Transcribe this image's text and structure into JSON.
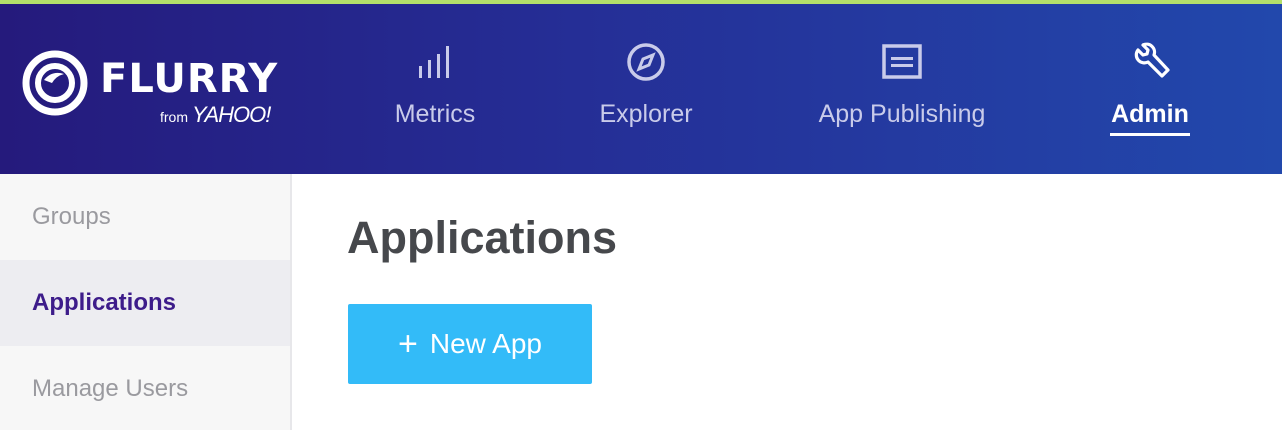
{
  "brand": {
    "name": "FLURRY",
    "from_text": "from",
    "partner": "YAHOO!"
  },
  "nav": {
    "items": [
      {
        "label": "Metrics",
        "icon": "bar-chart-icon"
      },
      {
        "label": "Explorer",
        "icon": "compass-icon"
      },
      {
        "label": "App Publishing",
        "icon": "document-icon"
      },
      {
        "label": "Admin",
        "icon": "wrench-icon"
      }
    ],
    "active": "Admin"
  },
  "sidebar": {
    "items": [
      {
        "label": "Groups"
      },
      {
        "label": "Applications"
      },
      {
        "label": "Manage Users"
      }
    ],
    "active": "Applications"
  },
  "main": {
    "title": "Applications",
    "new_app_button": {
      "icon": "+",
      "label": "New App"
    }
  },
  "colors": {
    "header_start": "#251a7c",
    "header_end": "#2248ac",
    "accent_line": "#b4e06a",
    "button": "#33bbf8",
    "active_sidebar_text": "#3d1c8a"
  }
}
